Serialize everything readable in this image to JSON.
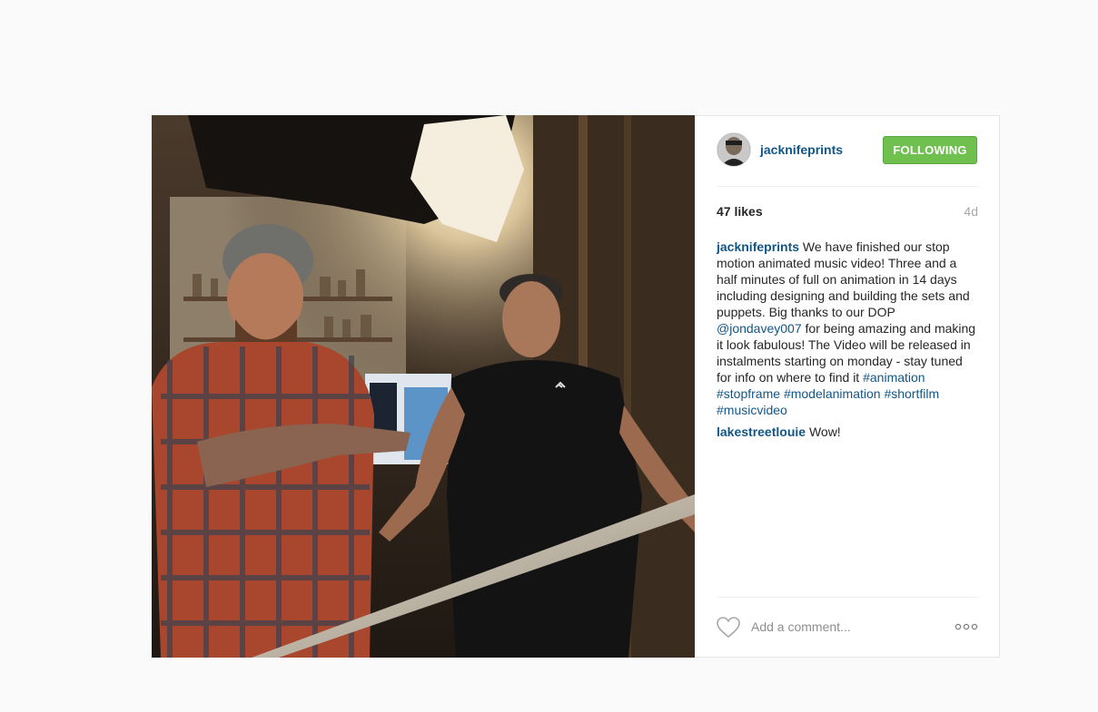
{
  "post": {
    "author": {
      "username": "jacknifeprints",
      "follow_label": "FOLLOWING",
      "follow_color": "#70c050"
    },
    "likes": "47 likes",
    "time_ago": "4d",
    "caption": {
      "username": "jacknifeprints",
      "text_1": " We have finished our stop motion animated music video! Three and a half minutes of full on animation in 14 days including designing and building the sets and puppets. Big thanks to our DOP ",
      "mention": "@jondavey007",
      "text_2": " for being amazing and making it look fabulous! The Video will be released in instalments starting on monday - stay tuned for info on where to find it ",
      "hashtags": [
        "#animation",
        "#stopframe",
        "#modelanimation",
        "#shortfilm",
        "#musicvideo"
      ]
    },
    "comments": [
      {
        "username": "lakestreetlouie",
        "text": " Wow!"
      }
    ],
    "footer": {
      "comment_placeholder": "Add a comment...",
      "like_icon": "heart-icon",
      "more_icon": "ellipsis-icon"
    },
    "photo": {
      "subject": "photo-two-men-in-studio",
      "accent": "#125688"
    }
  }
}
